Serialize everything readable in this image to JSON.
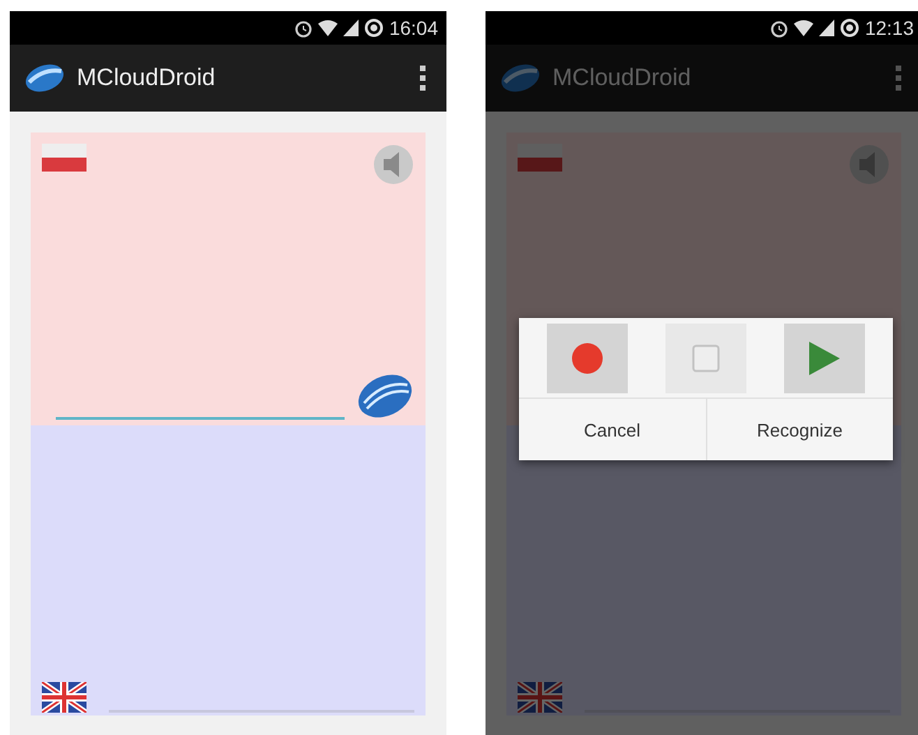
{
  "screens": [
    {
      "status_time": "16:04",
      "app_title": "MCloudDroid"
    },
    {
      "status_time": "12:13",
      "app_title": "MCloudDroid",
      "dialog": {
        "media_buttons": [
          {
            "kind": "record",
            "disabled": false
          },
          {
            "kind": "stop",
            "disabled": true
          },
          {
            "kind": "play",
            "disabled": false
          }
        ],
        "actions": [
          "Cancel",
          "Recognize"
        ]
      }
    }
  ]
}
